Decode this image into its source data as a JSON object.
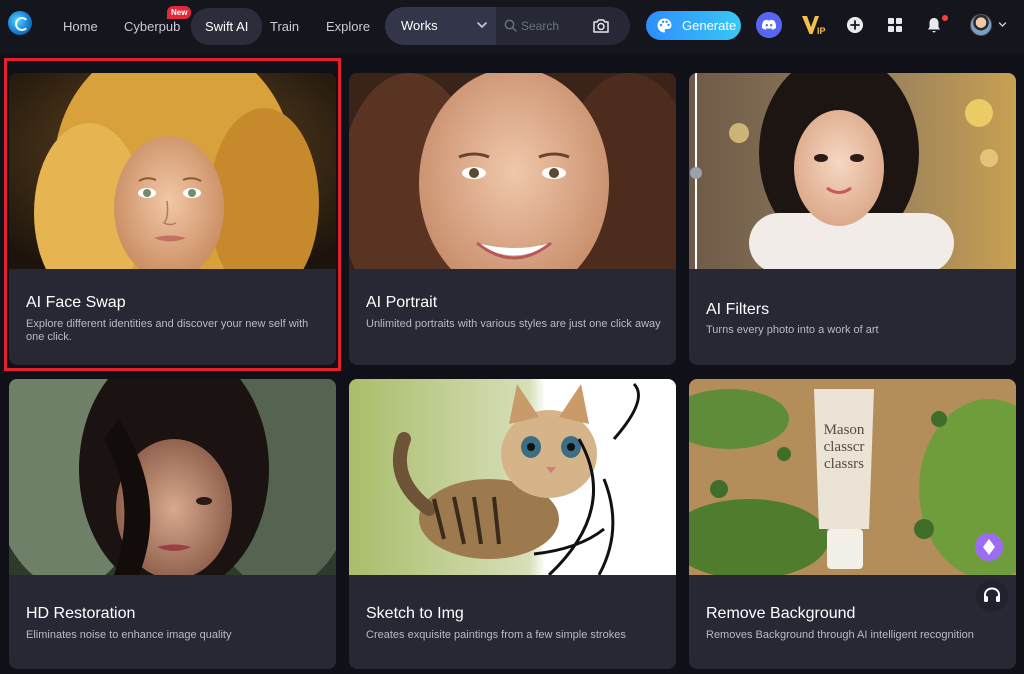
{
  "nav": {
    "home": "Home",
    "cyberpub": "Cyberpub",
    "new_badge": "New",
    "swift_ai": "Swift AI",
    "train": "Train",
    "explore": "Explore"
  },
  "search": {
    "scope": "Works",
    "placeholder": "Search"
  },
  "generate_label": "Generate",
  "cards": [
    {
      "title": "AI Face Swap",
      "desc": "Explore different identities and discover your new self with one click."
    },
    {
      "title": "AI Portrait",
      "desc": "Unlimited portraits with various styles are just one click away"
    },
    {
      "title": "AI Filters",
      "desc": "Turns every photo into a work of art"
    },
    {
      "title": "HD Restoration",
      "desc": "Eliminates noise to enhance image quality"
    },
    {
      "title": "Sketch to Img",
      "desc": "Creates exquisite paintings from a few simple strokes"
    },
    {
      "title": "Remove Background",
      "desc": "Removes Background through AI intelligent recognition"
    }
  ],
  "tube_text": "Mason classcr classrs",
  "colors": {
    "accent": "#2e8dff",
    "highlight": "#e3202b",
    "card_bg": "#272834",
    "page_bg": "#101118"
  }
}
